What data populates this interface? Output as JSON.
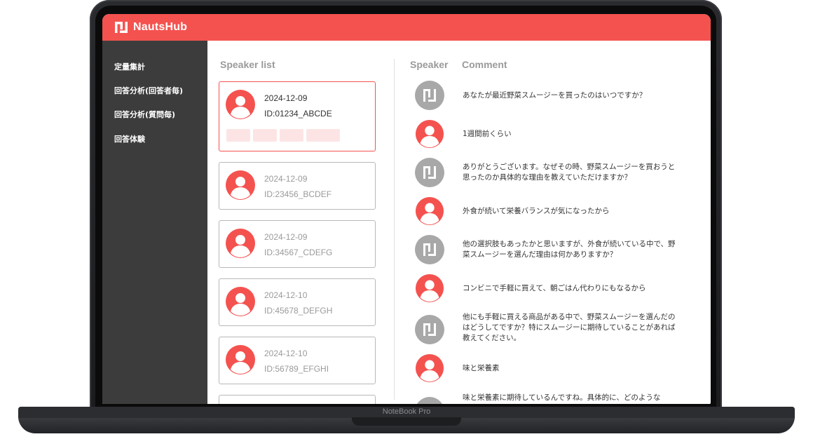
{
  "app": {
    "brand": "NautsHub",
    "colors": {
      "accent": "#f4524f",
      "sidebar": "#3c3c3c",
      "interviewer_avatar": "#a8a8a8"
    }
  },
  "device": {
    "model": "NoteBook Pro"
  },
  "sidebar": {
    "items": [
      {
        "label": "定量集計"
      },
      {
        "label": "回答分析(回答者毎)"
      },
      {
        "label": "回答分析(質問毎)"
      },
      {
        "label": "回答体験"
      }
    ]
  },
  "speaker_list": {
    "heading": "Speaker list",
    "speakers": [
      {
        "date": "2024-12-09",
        "id": "ID:01234_ABCDE",
        "selected": true
      },
      {
        "date": "2024-12-09",
        "id": "ID:23456_BCDEF",
        "selected": false
      },
      {
        "date": "2024-12-09",
        "id": "ID:34567_CDEFG",
        "selected": false
      },
      {
        "date": "2024-12-10",
        "id": "ID:45678_DEFGH",
        "selected": false
      },
      {
        "date": "2024-12-10",
        "id": "ID:56789_EFGHI",
        "selected": false
      }
    ]
  },
  "conversation": {
    "speaker_heading": "Speaker",
    "comment_heading": "Comment",
    "messages": [
      {
        "speaker": "interviewer",
        "text": "あなたが最近野菜スムージーを買ったのはいつですか？"
      },
      {
        "speaker": "respondent",
        "text": "1週間前くらい"
      },
      {
        "speaker": "interviewer",
        "text": "ありがとうございます。なぜその時、野菜スムージーを買おうと思ったのか具体的な理由を教えていただけますか？"
      },
      {
        "speaker": "respondent",
        "text": "外食が続いて栄養バランスが気になったから"
      },
      {
        "speaker": "interviewer",
        "text": "他の選択肢もあったかと思いますが、外食が続いている中で、野菜スムージーを選んだ理由は何かありますか？"
      },
      {
        "speaker": "respondent",
        "text": "コンビニで手軽に買えて、朝ごはん代わりにもなるから"
      },
      {
        "speaker": "interviewer",
        "text": "他にも手軽に買える商品がある中で、野菜スムージーを選んだのはどうしてですか？特にスムージーに期待していることがあれば教えてください。"
      },
      {
        "speaker": "respondent",
        "text": "味と栄養素"
      },
      {
        "speaker": "interviewer",
        "text": "味と栄養素に期待しているんですね。具体的に、どのような"
      }
    ]
  }
}
